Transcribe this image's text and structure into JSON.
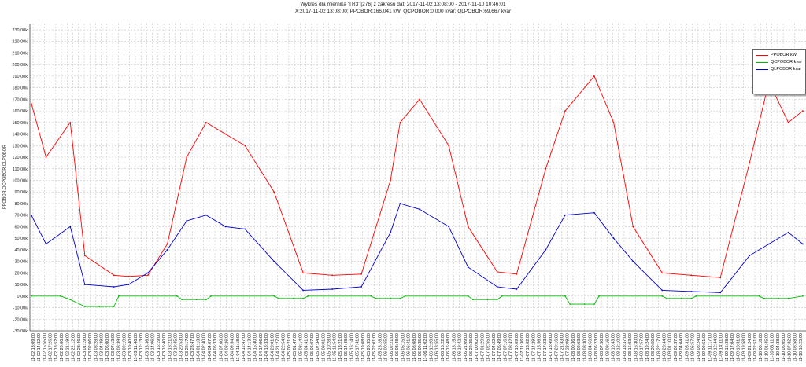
{
  "title_line1": "Wykres dla miernika 'TR3' [276] z zakresu dat: 2017-11-02 13:08:00 - 2017-11-10 10:46:01",
  "title_line2": "X:2017-11-02 13:08:00; PPOBOR:166,041 kW; QCPOBOR:0,000 kvar; QLPOBOR:69,667 kvar",
  "chart_data": {
    "type": "line",
    "ylabel": "PPOBOR,QCPOBOR,QLPOBOR",
    "ylim": [
      -30,
      230
    ],
    "y_ticks": [
      "-30,00k",
      "-20,00k",
      "-10,00k",
      "0,00k",
      "10,00k",
      "20,00k",
      "30,00k",
      "40,00k",
      "50,00k",
      "60,00k",
      "70,00k",
      "80,00k",
      "90,00k",
      "100,00k",
      "110,00k",
      "120,00k",
      "130,00k",
      "140,00k",
      "150,00k",
      "160,00k",
      "170,00k",
      "180,00k",
      "190,00k",
      "200,00k",
      "210,00k",
      "220,00k",
      "230,00k"
    ],
    "x_ticks": [
      "11-02 13:09:00",
      "11-02 14:32:00",
      "11-02 15:55:00",
      "11-02 17:26:00",
      "11-02 18:52:00",
      "11-02 20:06:00",
      "11-02 21:19:00",
      "11-02 22:12:00",
      "11-02 23:46:00",
      "11-03 01:19:00",
      "11-03 02:06:00",
      "11-03 03:28:00",
      "11-03 04:39:00",
      "11-03 06:00:00",
      "11-03 07:13:00",
      "11-03 08:39:00",
      "11-03 09:19:00",
      "11-03 10:40:00",
      "11-03 11:46:00",
      "11-03 12:13:00",
      "11-03 13:36:00",
      "11-03 14:06:00",
      "11-03 15:19:00",
      "11-03 16:40:00",
      "11-03 18:21:00",
      "11-03 19:45:00",
      "11-03 20:53:00",
      "11-03 22:17:00",
      "11-03 23:47:00",
      "11-04 01:13:00",
      "11-04 02:40:00",
      "11-04 04:07:00",
      "11-04 05:33:00",
      "11-04 07:00:00",
      "11-04 08:26:00",
      "11-04 09:54:00",
      "11-04 11:18:00",
      "11-04 12:47:00",
      "11-04 14:13:00",
      "11-04 15:40:00",
      "11-04 17:06:00",
      "11-04 18:33:00",
      "11-04 20:01:00",
      "11-04 21:27:00",
      "11-04 22:54:00",
      "11-05 00:21:00",
      "11-05 01:47:00",
      "11-05 03:14:00",
      "11-05 04:41:00",
      "11-05 06:07:00",
      "11-05 07:34:00",
      "11-05 09:01:00",
      "11-05 10:28:00",
      "11-05 11:54:00",
      "11-05 13:21:00",
      "11-05 14:48:00",
      "11-05 16:14:00",
      "11-05 17:41:00",
      "11-05 19:08:00",
      "11-05 20:35:00",
      "11-05 22:01:00",
      "11-05 23:28:00",
      "11-06 00:55:00",
      "11-06 02:21:00",
      "11-06 03:48:00",
      "11-06 05:15:00",
      "11-06 06:41:00",
      "11-06 08:08:00",
      "11-06 09:35:00",
      "11-06 11:02:00",
      "11-06 12:28:00",
      "11-06 13:55:00",
      "11-06 15:22:00",
      "11-06 16:48:00",
      "11-06 18:15:00",
      "11-06 19:42:00",
      "11-06 21:09:00",
      "11-06 22:35:00",
      "11-07 00:02:00",
      "11-07 01:29:00",
      "11-07 02:55:00",
      "11-07 04:22:00",
      "11-07 05:49:00",
      "11-07 07:16:00",
      "11-07 08:42:00",
      "11-07 10:09:00",
      "11-07 11:36:00",
      "11-07 13:02:00",
      "11-07 14:29:00",
      "11-07 15:56:00",
      "11-07 17:23:00",
      "11-07 18:49:00",
      "11-07 20:16:00",
      "11-07 21:43:00",
      "11-07 23:09:00",
      "11-08 00:36:00",
      "11-08 02:03:00",
      "11-08 03:30:00",
      "11-08 04:56:00",
      "11-08 06:23:00",
      "11-08 07:50:00",
      "11-08 09:16:00",
      "11-08 10:43:00",
      "11-08 12:10:00",
      "11-08 13:37:00",
      "11-08 15:03:00",
      "11-08 16:30:00",
      "11-08 17:57:00",
      "11-08 19:24:00",
      "11-08 20:50:00",
      "11-08 22:17:00",
      "11-08 23:44:00",
      "11-09 01:10:00",
      "11-09 02:37:00",
      "11-09 04:04:00",
      "11-09 05:31:00",
      "11-09 06:57:00",
      "11-09 08:24:00",
      "11-09 09:51:00",
      "11-09 11:17:00",
      "11-09 12:44:00",
      "11-09 14:11:00",
      "11-09 15:38:00",
      "11-09 17:04:00",
      "11-09 18:31:00",
      "11-09 19:58:00",
      "11-09 21:24:00",
      "11-09 22:51:00",
      "11-10 00:18:00",
      "11-10 01:45:00",
      "11-10 03:11:00",
      "11-10 04:38:00",
      "11-10 06:05:00",
      "11-10 07:32:00",
      "11-10 08:58:00",
      "11-10 10:25:00"
    ],
    "grid": true,
    "legend_position": "top-right",
    "series": [
      {
        "name": "PPOBOR kW",
        "color": "#ff0000",
        "x": [
          0,
          0.15,
          0.4,
          0.55,
          0.85,
          1.0,
          1.2,
          1.4,
          1.6,
          1.8,
          2.0,
          2.2,
          2.5,
          2.8,
          3.1,
          3.4,
          3.7,
          3.8,
          4.0,
          4.3,
          4.5,
          4.8,
          5.0,
          5.3,
          5.5,
          5.8,
          6.0,
          6.2,
          6.5,
          6.8,
          7.1,
          7.4,
          7.6,
          7.8,
          7.95
        ],
        "values": [
          166,
          120,
          150,
          35,
          18,
          17,
          18,
          45,
          120,
          150,
          140,
          130,
          90,
          20,
          18,
          19,
          100,
          150,
          170,
          130,
          60,
          21,
          19,
          110,
          160,
          190,
          150,
          60,
          20,
          18,
          16,
          115,
          185,
          150,
          160
        ]
      },
      {
        "name": "QCPOBOR kvar",
        "color": "#00bb00",
        "x": [
          0,
          0.3,
          0.4,
          0.55,
          0.7,
          0.85,
          0.9,
          1.5,
          1.55,
          1.7,
          1.8,
          1.85,
          2.5,
          2.55,
          2.7,
          2.8,
          2.85,
          3.5,
          3.55,
          3.7,
          3.8,
          3.85,
          4.5,
          4.55,
          4.7,
          4.8,
          4.85,
          5.5,
          5.55,
          5.7,
          5.8,
          5.85,
          6.5,
          6.55,
          6.7,
          6.8,
          6.85,
          7.5,
          7.55,
          7.7,
          7.8,
          7.95
        ],
        "values": [
          0,
          0,
          -3,
          -9,
          -9,
          -9,
          0,
          0,
          -3,
          -3,
          -3,
          0,
          0,
          -2,
          -2,
          -2,
          0,
          0,
          -2,
          -2,
          -2,
          0,
          0,
          -3,
          -3,
          -3,
          0,
          0,
          -7,
          -7,
          -7,
          0,
          0,
          -2,
          -2,
          -2,
          0,
          0,
          -2,
          -2,
          -2,
          0
        ]
      },
      {
        "name": "QLPOBOR kvar",
        "color": "#0000cc",
        "x": [
          0,
          0.15,
          0.4,
          0.55,
          0.85,
          1.0,
          1.2,
          1.4,
          1.6,
          1.8,
          2.0,
          2.2,
          2.5,
          2.8,
          3.1,
          3.4,
          3.7,
          3.8,
          4.0,
          4.3,
          4.5,
          4.8,
          5.0,
          5.3,
          5.5,
          5.8,
          6.0,
          6.2,
          6.5,
          6.8,
          7.1,
          7.4,
          7.6,
          7.8,
          7.95
        ],
        "values": [
          69.667,
          45,
          60,
          10,
          8,
          10,
          20,
          40,
          65,
          70,
          60,
          58,
          30,
          5,
          6,
          8,
          55,
          80,
          75,
          60,
          25,
          8,
          6,
          40,
          70,
          72,
          50,
          30,
          5,
          4,
          3,
          35,
          45,
          55,
          45
        ]
      }
    ]
  }
}
